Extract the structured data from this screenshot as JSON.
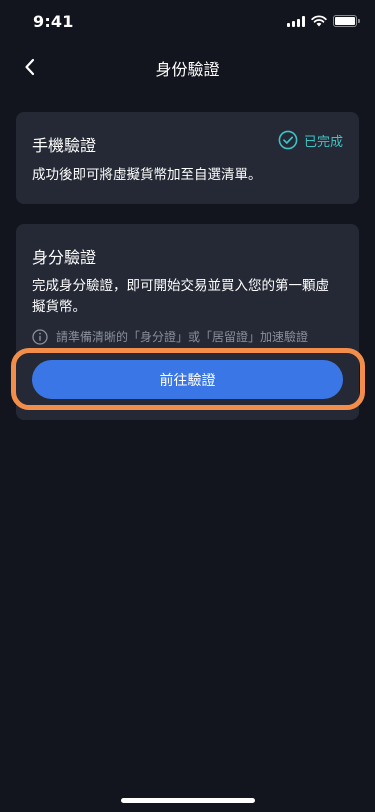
{
  "status_bar": {
    "time": "9:41"
  },
  "nav": {
    "title": "身份驗證",
    "back_icon": "chevron-left-icon"
  },
  "phone_verification": {
    "title": "手機驗證",
    "status": "已完成",
    "status_icon": "check-circle-icon",
    "description": "成功後即可將虛擬貨幣加至自選清單。"
  },
  "identity_verification": {
    "title": "身分驗證",
    "description": "完成身分驗證，即可開始交易並買入您的第一顆虛擬貨幣。",
    "hint_icon": "info-icon",
    "hint": "請準備清晰的「身分證」或「居留證」加速驗證",
    "button_label": "前往驗證"
  },
  "colors": {
    "background": "#12151d",
    "card": "#242935",
    "accent_teal": "#3ec3c5",
    "primary_button": "#3b76e7",
    "highlight": "#f28e4a"
  }
}
